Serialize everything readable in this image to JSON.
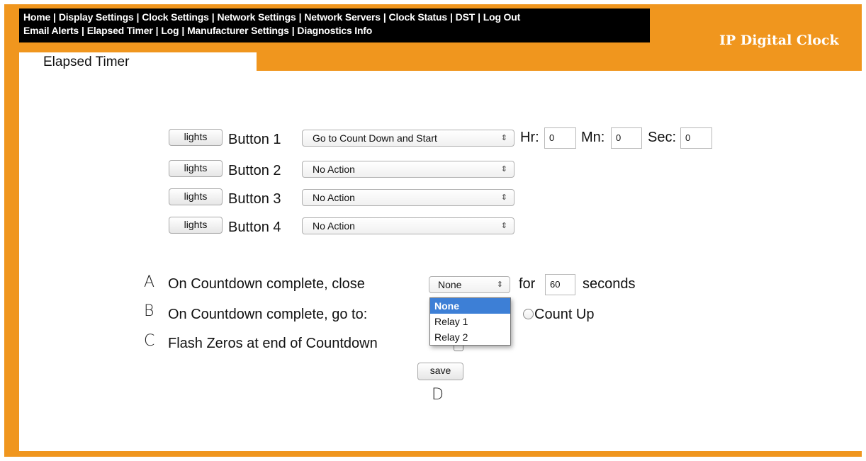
{
  "nav": {
    "row1": [
      "Home",
      "Display Settings",
      "Clock Settings",
      "Network Settings",
      "Network Servers",
      "Clock Status",
      "DST",
      "Log Out"
    ],
    "row2": [
      "Email Alerts",
      "Elapsed Timer",
      "Log",
      "Manufacturer Settings",
      "Diagnostics Info"
    ],
    "separator": "|"
  },
  "brand": "IP Digital Clock",
  "tab_title": "Elapsed Timer",
  "buttons": [
    {
      "lights_label": "lights",
      "label": "Button 1",
      "action": "Go to Count Down and Start"
    },
    {
      "lights_label": "lights",
      "label": "Button 2",
      "action": "No Action"
    },
    {
      "lights_label": "lights",
      "label": "Button 3",
      "action": "No Action"
    },
    {
      "lights_label": "lights",
      "label": "Button 4",
      "action": "No Action"
    }
  ],
  "time": {
    "hr_label": "Hr:",
    "hr_value": "0",
    "mn_label": "Mn:",
    "mn_value": "0",
    "sec_label": "Sec:",
    "sec_value": "0"
  },
  "rows": {
    "a_letter": "A",
    "a_text": "On Countdown complete, close",
    "a_select": "None",
    "a_for": "for",
    "a_seconds_value": "60",
    "a_seconds": "seconds",
    "b_letter": "B",
    "b_text": "On Countdown complete, go to:",
    "b_option_countup": "Count Up",
    "c_letter": "C",
    "c_text": "Flash Zeros at end of Countdown",
    "d_letter": "D"
  },
  "dropdown_options": [
    "None",
    "Relay 1",
    "Relay 2"
  ],
  "save_label": "save",
  "colors": {
    "frame": "#f0961e",
    "navbar": "#000000",
    "selected": "#3d7fd6"
  }
}
